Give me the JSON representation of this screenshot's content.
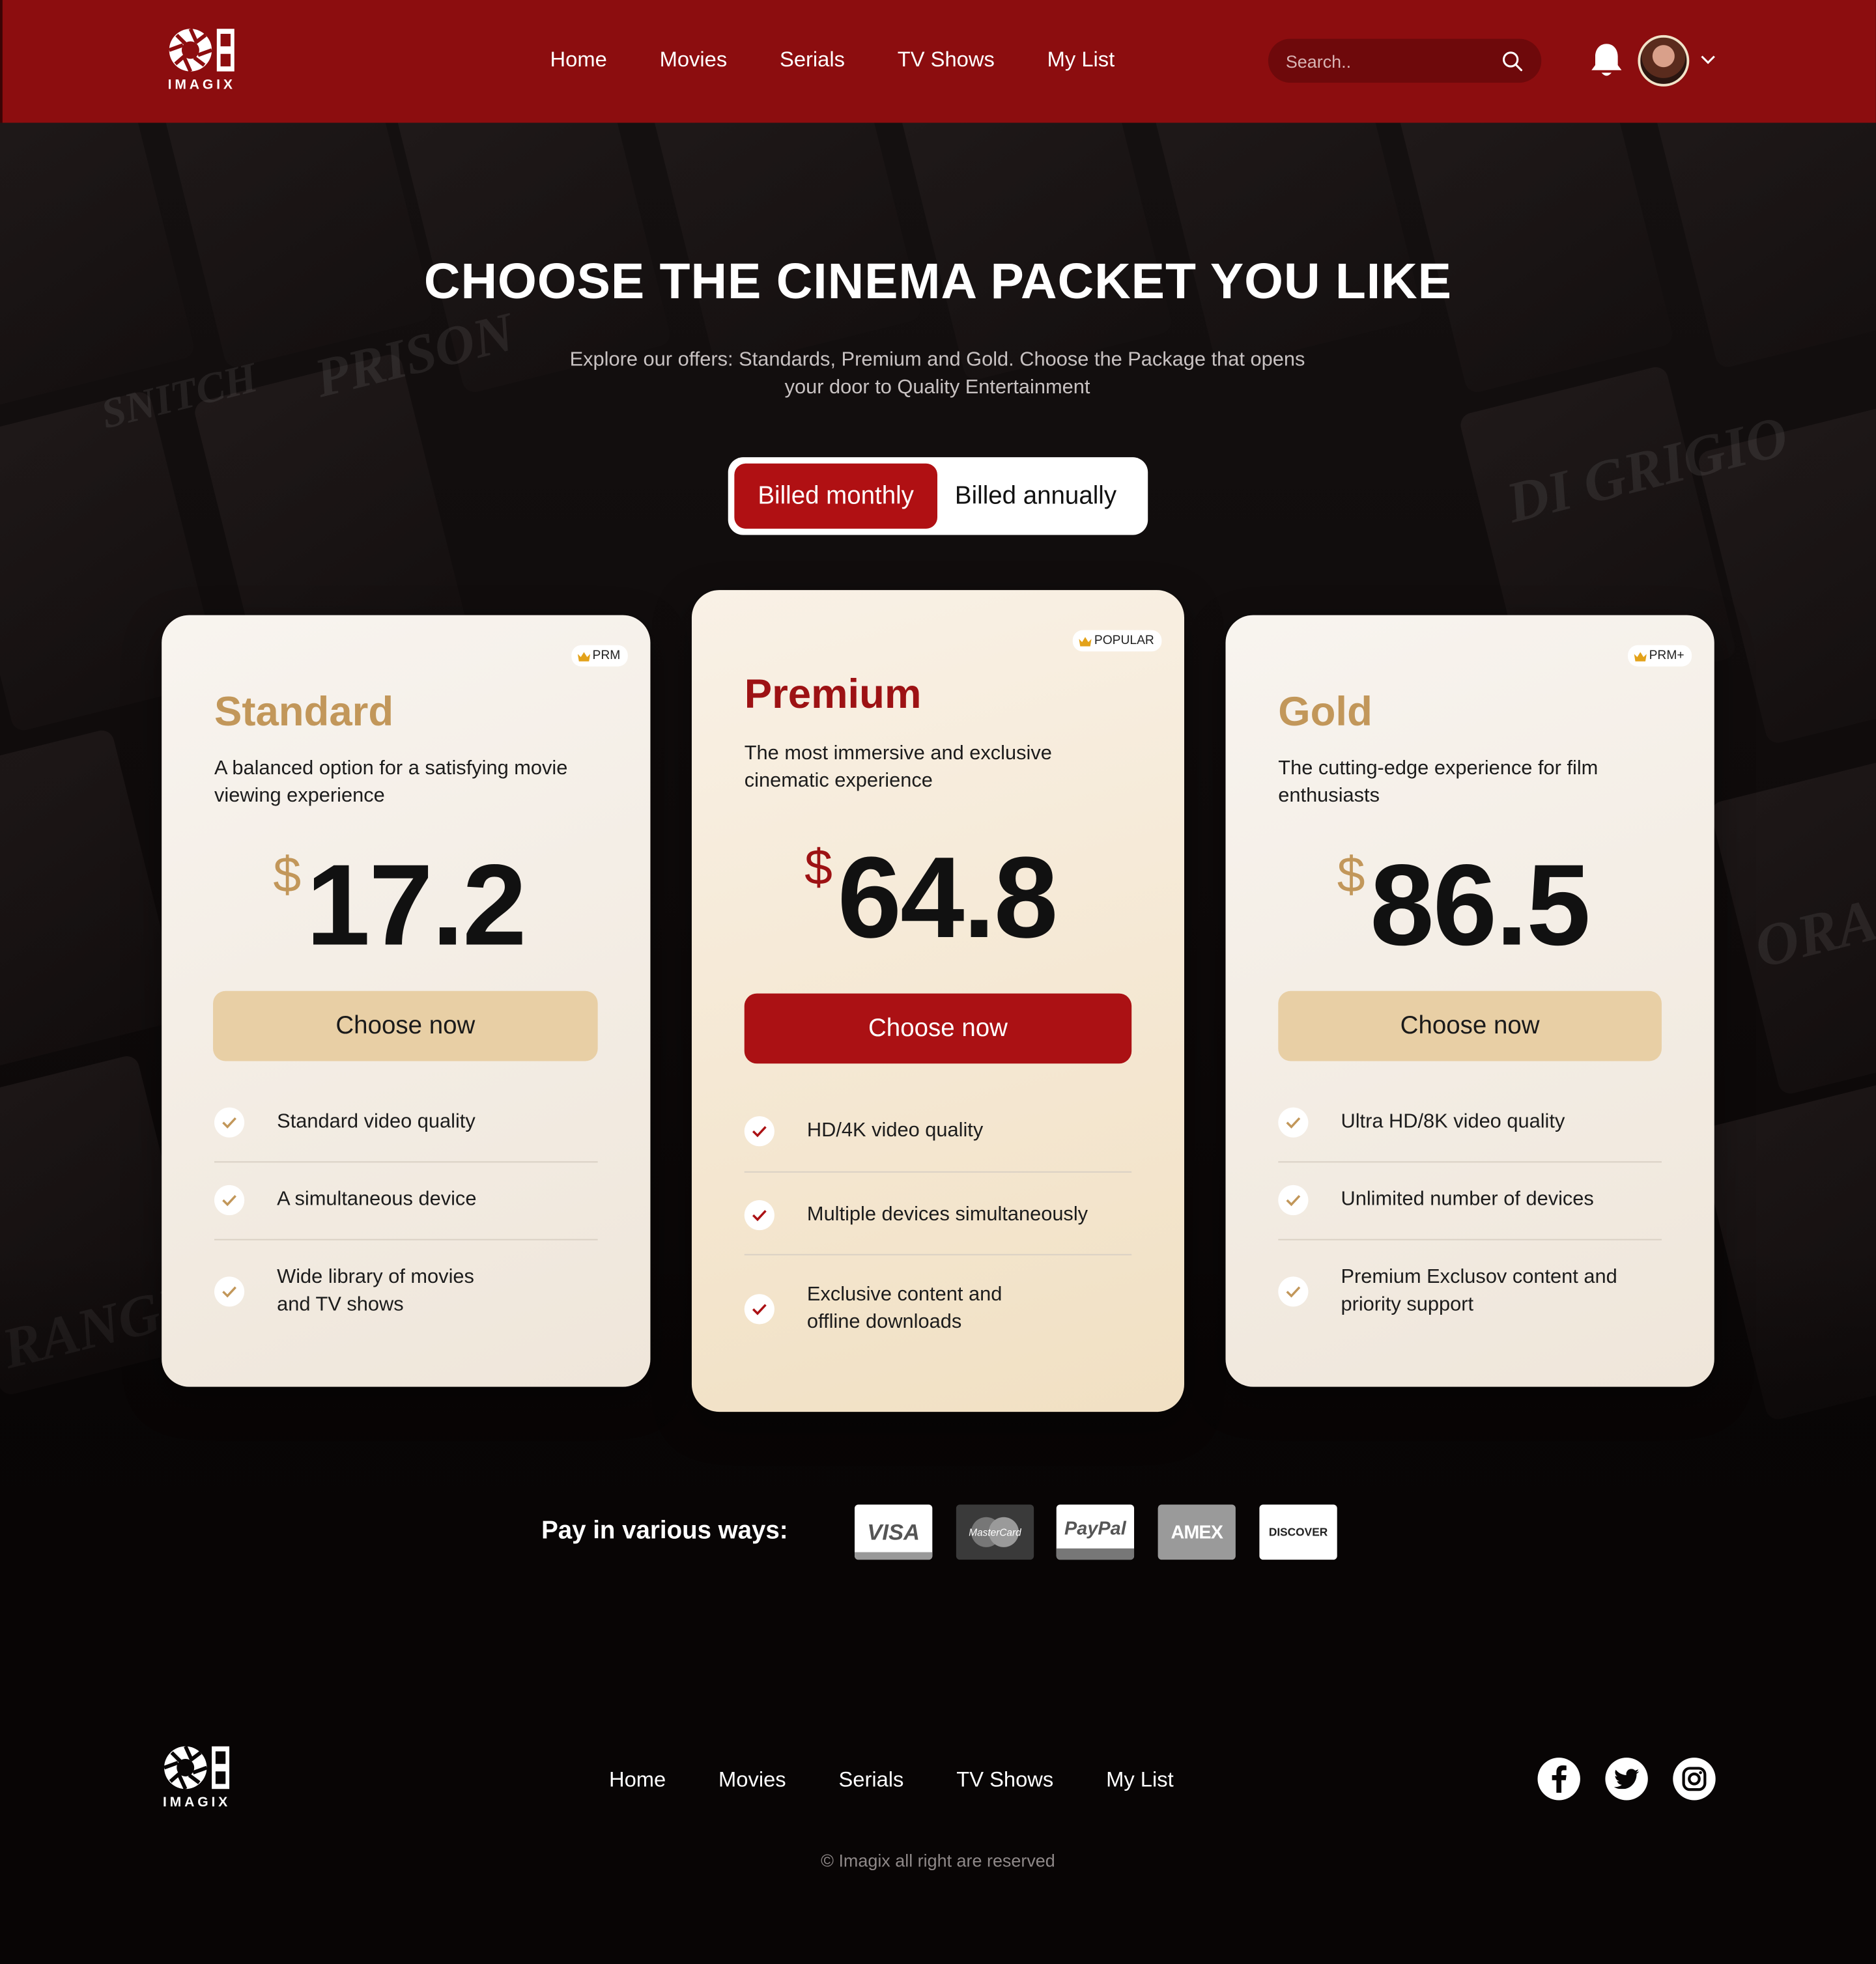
{
  "brand": {
    "name": "IMAGIX"
  },
  "nav": {
    "items": [
      "Home",
      "Movies",
      "Serials",
      "TV Shows",
      "My List"
    ]
  },
  "search": {
    "placeholder": "Search.."
  },
  "hero": {
    "title": "CHOOSE THE CINEMA PACKET YOU LIKE",
    "subtitle_line1": "Explore our offers: Standards, Premium and Gold. Choose the Package that opens",
    "subtitle_line2": "your door to Quality Entertainment"
  },
  "billing": {
    "monthly": "Billed monthly",
    "annually": "Billed annually",
    "selected": "monthly"
  },
  "plans": [
    {
      "badge": "PRM",
      "name": "Standard",
      "desc_line1": "A balanced option for a satisfying movie",
      "desc_line2": "viewing experience",
      "currency": "$",
      "price": "17.2",
      "cta": "Choose now",
      "features": [
        {
          "line1": "Standard video quality",
          "line2": ""
        },
        {
          "line1": "A simultaneous device",
          "line2": ""
        },
        {
          "line1": "Wide library of movies",
          "line2": "and TV shows"
        }
      ]
    },
    {
      "badge": "POPULAR",
      "name": "Premium",
      "desc_line1": "The most immersive and exclusive",
      "desc_line2": "cinematic experience",
      "currency": "$",
      "price": "64.8",
      "cta": "Choose now",
      "features": [
        {
          "line1": "HD/4K video quality",
          "line2": ""
        },
        {
          "line1": "Multiple devices simultaneously",
          "line2": ""
        },
        {
          "line1": "Exclusive content and",
          "line2": "offline downloads"
        }
      ]
    },
    {
      "badge": "PRM+",
      "name": "Gold",
      "desc_line1": "The cutting-edge experience for film",
      "desc_line2": "enthusiasts",
      "currency": "$",
      "price": "86.5",
      "cta": "Choose now",
      "features": [
        {
          "line1": "Ultra HD/8K video quality",
          "line2": ""
        },
        {
          "line1": "Unlimited number of devices",
          "line2": ""
        },
        {
          "line1": "Premium Exclusov content and",
          "line2": "priority support"
        }
      ]
    }
  ],
  "payment": {
    "label": "Pay in various ways:",
    "methods": [
      "VISA",
      "MasterCard",
      "PayPal",
      "AMEX",
      "DISCOVER"
    ]
  },
  "footer": {
    "nav": [
      "Home",
      "Movies",
      "Serials",
      "TV Shows",
      "My List"
    ],
    "social": [
      "facebook-icon",
      "twitter-icon",
      "instagram-icon"
    ],
    "copyright": "© Imagix all right are reserved"
  },
  "colors": {
    "brand_red": "#8c0d0f",
    "accent_red": "#ab1114",
    "gold": "#c2975a",
    "cta_light": "#e8cfa5"
  }
}
